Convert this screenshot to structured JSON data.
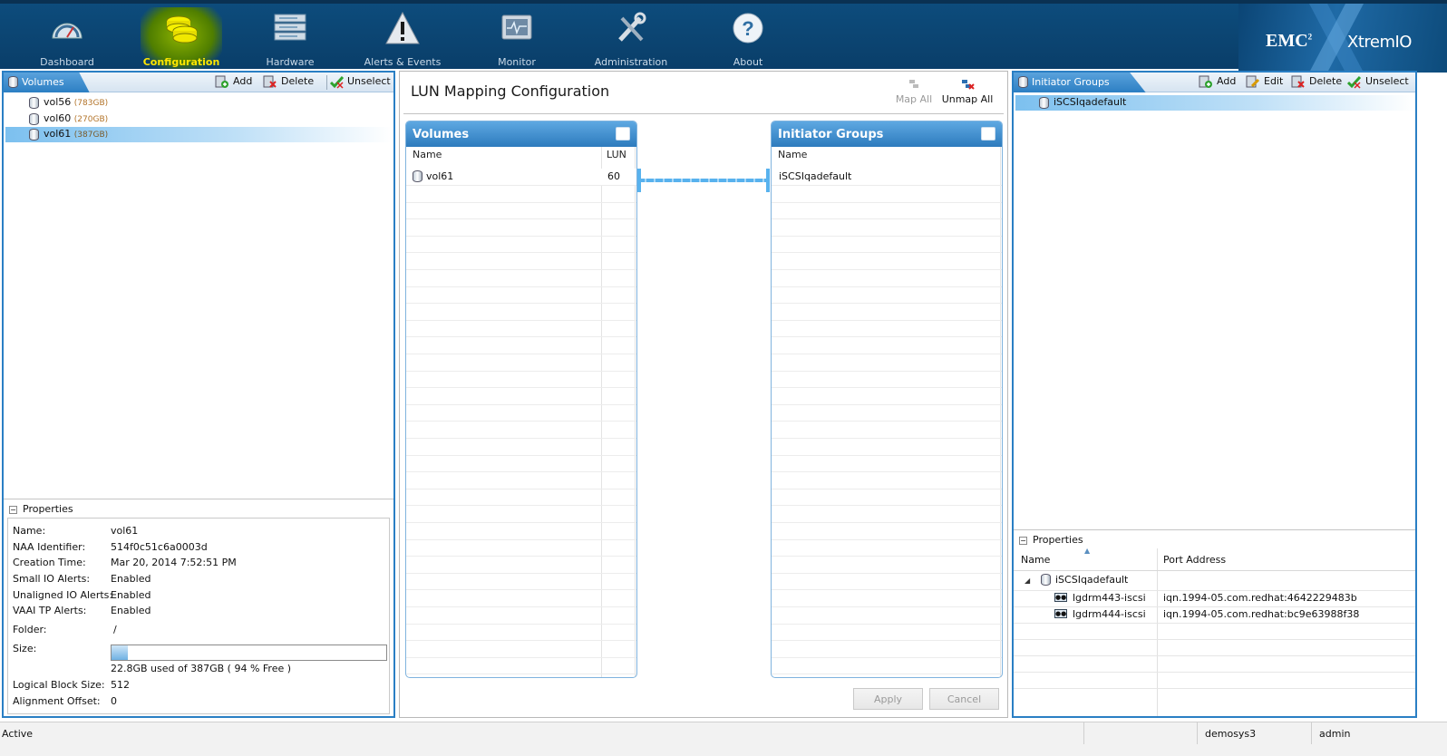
{
  "nav": {
    "items": [
      {
        "label": "Dashboard",
        "icon": "gauge-icon"
      },
      {
        "label": "Configuration",
        "icon": "disks-icon"
      },
      {
        "label": "Hardware",
        "icon": "server-rack-icon"
      },
      {
        "label": "Alerts & Events",
        "icon": "warning-icon"
      },
      {
        "label": "Monitor",
        "icon": "monitor-icon"
      },
      {
        "label": "Administration",
        "icon": "tools-icon"
      },
      {
        "label": "About",
        "icon": "help-icon"
      }
    ],
    "active": "Configuration"
  },
  "brand": {
    "emc": "EMC",
    "sup": "2",
    "product": "XtremIO"
  },
  "volumes_panel": {
    "tab": "Volumes",
    "add": "Add",
    "delete": "Delete",
    "unselect": "Unselect",
    "items": [
      {
        "name": "vol56",
        "size": "(783GB)"
      },
      {
        "name": "vol60",
        "size": "(270GB)"
      },
      {
        "name": "vol61",
        "size": "(387GB)"
      }
    ],
    "selected": "vol61"
  },
  "volume_props": {
    "header": "Properties",
    "name": {
      "k": "Name:",
      "v": "vol61"
    },
    "naa": {
      "k": "NAA Identifier:",
      "v": "514f0c51c6a0003d"
    },
    "created": {
      "k": "Creation Time:",
      "v": "Mar 20, 2014 7:52:51 PM"
    },
    "small_io": {
      "k": "Small IO Alerts:",
      "v": "Enabled"
    },
    "unaligned": {
      "k": "Unaligned IO Alerts:",
      "v": "Enabled"
    },
    "vaai": {
      "k": "VAAI TP Alerts:",
      "v": "Enabled"
    },
    "folder": {
      "k": "Folder:",
      "v": "/"
    },
    "size": {
      "k": "Size:",
      "v": "22.8GB used of 387GB ( 94 % Free )",
      "used_fraction": 0.06
    },
    "lbs": {
      "k": "Logical Block Size:",
      "v": "512"
    },
    "align": {
      "k": "Alignment Offset:",
      "v": "0"
    }
  },
  "lun": {
    "title": "LUN Mapping Configuration",
    "map_all": "Map All",
    "unmap_all": "Unmap All",
    "volumes_grid": {
      "title": "Volumes",
      "col_name": "Name",
      "col_lun": "LUN",
      "rows": [
        {
          "name": "vol61",
          "lun": "60"
        }
      ]
    },
    "ig_grid": {
      "title": "Initiator Groups",
      "col_name": "Name",
      "rows": [
        {
          "name": "iSCSIqadefault"
        }
      ]
    },
    "apply": "Apply",
    "cancel": "Cancel"
  },
  "ig_panel": {
    "tab": "Initiator Groups",
    "add": "Add",
    "edit": "Edit",
    "delete": "Delete",
    "unselect": "Unselect",
    "items": [
      {
        "name": "iSCSIqadefault"
      }
    ],
    "props": {
      "header": "Properties",
      "col_name": "Name",
      "col_port": "Port Address",
      "group": "iSCSIqadefault",
      "initiators": [
        {
          "name": "lgdrm443-iscsi",
          "port": "iqn.1994-05.com.redhat:4642229483b"
        },
        {
          "name": "lgdrm444-iscsi",
          "port": "iqn.1994-05.com.redhat:bc9e63988f38"
        }
      ]
    }
  },
  "status": {
    "state": "Active",
    "cluster": "demosys3",
    "user": "admin"
  },
  "colors": {
    "accent": "#2a7fc4",
    "topbar": "#0d4c7c",
    "active_nav_label": "#ffe600"
  }
}
